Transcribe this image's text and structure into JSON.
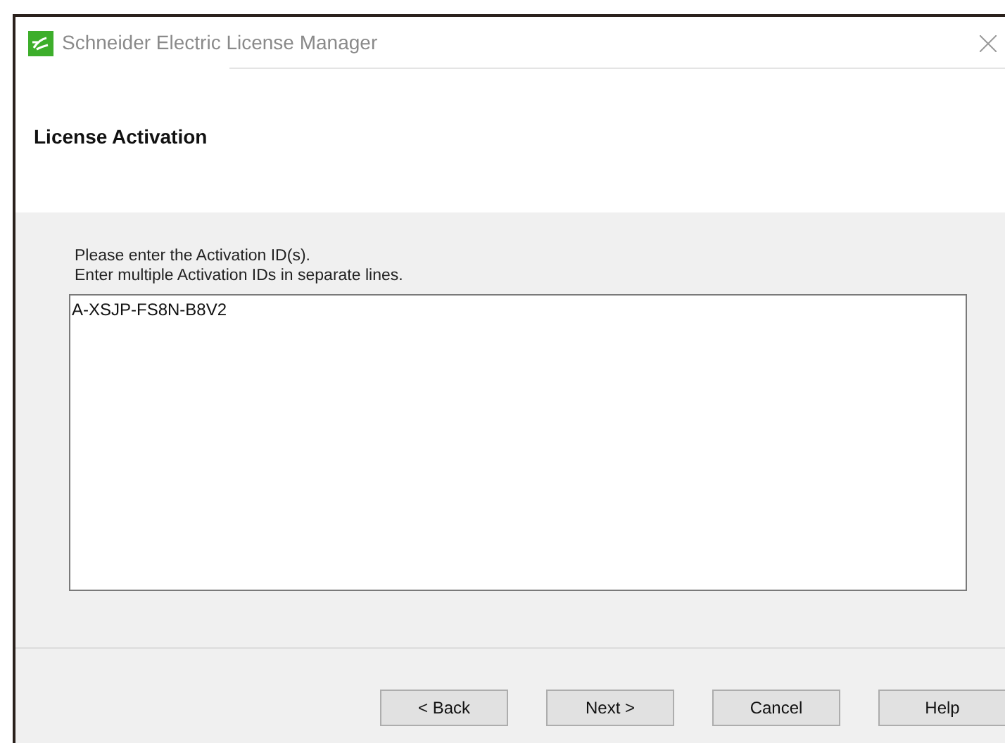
{
  "window": {
    "title": "Schneider Electric License Manager"
  },
  "header": {
    "title": "License Activation"
  },
  "instructions": [
    "Please enter the Activation ID(s).",
    "Enter multiple Activation IDs in separate lines."
  ],
  "activation_ids": {
    "value": "A-XSJP-FS8N-B8V2"
  },
  "buttons": [
    {
      "label": "< Back"
    },
    {
      "label": "Next >"
    },
    {
      "label": "Cancel"
    },
    {
      "label": "Help"
    }
  ]
}
